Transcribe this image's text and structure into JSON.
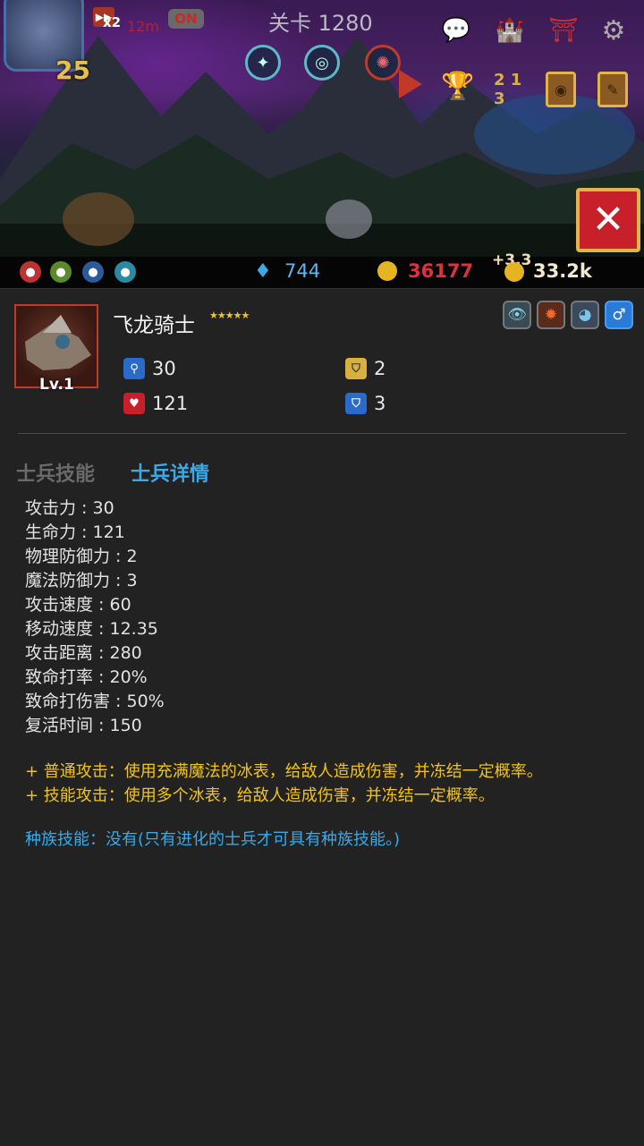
{
  "hud": {
    "level": "25",
    "speed_multiplier": "x2",
    "timer": "12m",
    "auto_toggle": "ON",
    "stage": "关卡 1280"
  },
  "resources": {
    "gems": "744",
    "medals": "36177",
    "gold_delta": "+3.3",
    "gold": "33.2k"
  },
  "unit": {
    "name": "飞龙骑士",
    "stars": "★★★★★",
    "level_badge": "Lv.1",
    "attack": "30",
    "health": "121",
    "physical_defense": "2",
    "magic_defense": "3"
  },
  "tabs": {
    "skills": "士兵技能",
    "details": "士兵详情"
  },
  "details": [
    "攻击力 : 30",
    "生命力 : 121",
    "物理防御力 : 2",
    "魔法防御力 : 3",
    "攻击速度 : 60",
    "移动速度 : 12.35",
    "攻击距离 : 280",
    "致命打率 : 20%",
    "致命打伤害 : 50%",
    "复活时间 : 150"
  ],
  "skills": {
    "normal_attack": "+ 普通攻击：使用充满魔法的冰表，给敌人造成伤害，并冻结一定概率。",
    "skill_attack": "+ 技能攻击：使用多个冰表，给敌人造成伤害，并冻结一定概率。",
    "race_skill": "种族技能：没有(只有进化的士兵才可具有种族技能。)"
  },
  "colors": {
    "accent_blue": "#3aa9e6",
    "skill_yellow": "#f2c414",
    "medal_red": "#e0303a",
    "close_red": "#c8202a"
  }
}
